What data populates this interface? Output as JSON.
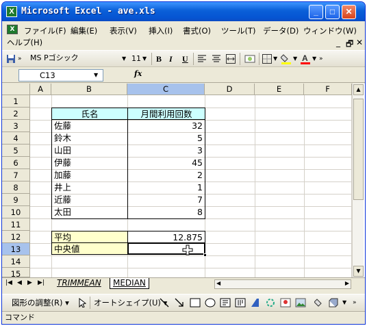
{
  "window": {
    "title": "Microsoft Excel - ave.xls",
    "app_icon": "X",
    "buttons": {
      "minimize": "_",
      "maximize": "□",
      "close": "✕"
    }
  },
  "menubar": {
    "items": [
      "ファイル(F)",
      "編集(E)",
      "表示(V)",
      "挿入(I)",
      "書式(O)",
      "ツール(T)",
      "データ(D)",
      "ウィンドウ(W)"
    ],
    "help": "ヘルプ(H)",
    "mdi_controls": [
      "_",
      "🗗",
      "✕"
    ]
  },
  "toolbar": {
    "font_name": "MS Pゴシック",
    "font_size": "11",
    "bold": "B",
    "italic": "I",
    "underline": "U"
  },
  "formula_bar": {
    "name_box": "C13",
    "fx": "fx",
    "content": ""
  },
  "sheet": {
    "columns": [
      "A",
      "B",
      "C",
      "D",
      "E",
      "F"
    ],
    "rows": [
      "1",
      "2",
      "3",
      "4",
      "5",
      "6",
      "7",
      "8",
      "9",
      "10",
      "11",
      "12",
      "13",
      "14",
      "15"
    ],
    "header_name": "氏名",
    "header_count": "月間利用回数",
    "names": [
      "佐藤",
      "鈴木",
      "山田",
      "伊藤",
      "加藤",
      "井上",
      "近藤",
      "太田"
    ],
    "counts": [
      "32",
      "5",
      "3",
      "45",
      "2",
      "1",
      "7",
      "8"
    ],
    "label_avg": "平均",
    "value_avg": "12.875",
    "label_median": "中央値",
    "value_median": ""
  },
  "tabs": {
    "sheets": [
      "TRIMMEAN",
      "MEDIAN"
    ],
    "active": "MEDIAN"
  },
  "drawing": {
    "draw": "図形の調整(R) ▾",
    "autoshape": "オートシェイプ(U) ▾"
  },
  "status": {
    "text": "コマンド"
  },
  "colors": {
    "header_fill": "#ccffff",
    "label_fill": "#ffffcc",
    "selection": "#a7c2ec"
  }
}
